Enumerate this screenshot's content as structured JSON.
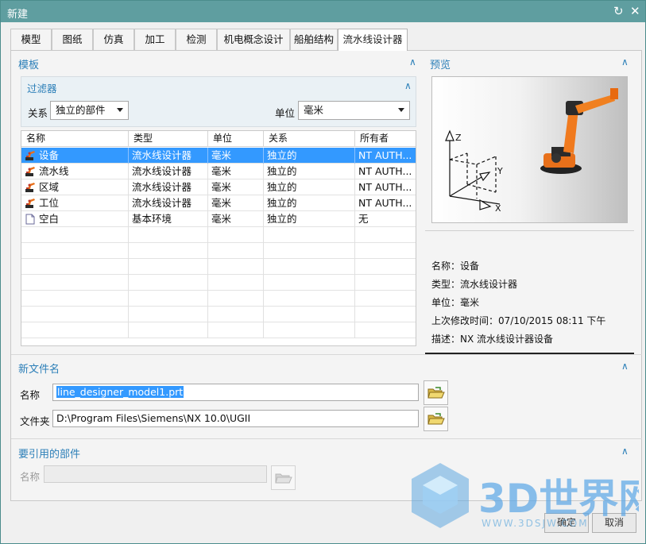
{
  "window": {
    "title": "新建"
  },
  "tabs": [
    "模型",
    "图纸",
    "仿真",
    "加工",
    "检测",
    "机电概念设计",
    "船舶结构",
    "流水线设计器"
  ],
  "template": {
    "header": "模板",
    "filter": {
      "header": "过滤器",
      "relation_label": "关系",
      "relation_value": "独立的部件",
      "unit_label": "单位",
      "unit_value": "毫米"
    },
    "columns": [
      "名称",
      "类型",
      "单位",
      "关系",
      "所有者"
    ],
    "rows": [
      {
        "name": "设备",
        "type": "流水线设计器",
        "unit": "毫米",
        "relation": "独立的",
        "owner": "NT AUTH...",
        "icon": "robot-icon",
        "selected": true
      },
      {
        "name": "流水线",
        "type": "流水线设计器",
        "unit": "毫米",
        "relation": "独立的",
        "owner": "NT AUTH...",
        "icon": "robot-icon"
      },
      {
        "name": "区域",
        "type": "流水线设计器",
        "unit": "毫米",
        "relation": "独立的",
        "owner": "NT AUTH...",
        "icon": "robot-icon"
      },
      {
        "name": "工位",
        "type": "流水线设计器",
        "unit": "毫米",
        "relation": "独立的",
        "owner": "NT AUTH...",
        "icon": "robot-icon"
      },
      {
        "name": "空白",
        "type": "基本环境",
        "unit": "毫米",
        "relation": "独立的",
        "owner": "无",
        "icon": "blank-document-icon"
      }
    ]
  },
  "preview": {
    "header": "预览",
    "axes": {
      "z": "Z",
      "y": "Y",
      "x": "X"
    },
    "name_label": "名称：",
    "name_value": "设备",
    "type_label": "类型：",
    "type_value": "流水线设计器",
    "unit_label": "单位：",
    "unit_value": "毫米",
    "modified_label": "上次修改时间：",
    "modified_value": "07/10/2015 08:11 下午",
    "desc_label": "描述：",
    "desc_value": "NX 流水线设计器设备"
  },
  "new_file": {
    "header": "新文件名",
    "name_label": "名称",
    "name_value": "line_designer_model1.prt",
    "folder_label": "文件夹",
    "folder_value": "D:\\Program Files\\Siemens\\NX 10.0\\UGII"
  },
  "referenced": {
    "header": "要引用的部件",
    "name_label": "名称",
    "name_value": ""
  },
  "buttons": {
    "ok": "确定",
    "cancel": "取消"
  },
  "watermark": {
    "text": "3D世界网",
    "url": "WWW.3DSJW.COM"
  },
  "colors": {
    "titlebar": "#5f9ea0",
    "section_header": "#2c7fb8",
    "selection": "#3399ff"
  }
}
